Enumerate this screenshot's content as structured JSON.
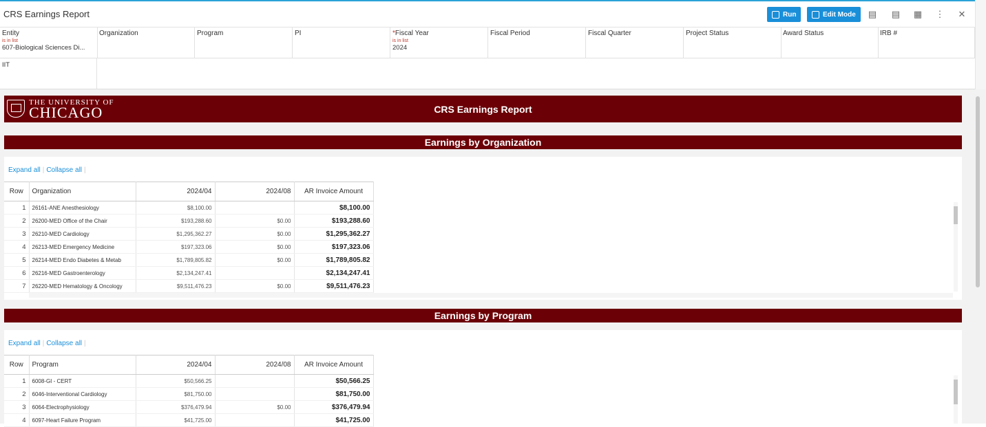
{
  "app": {
    "title": "CRS Earnings Report"
  },
  "toolbar": {
    "run_label": "Run",
    "edit_label": "Edit Mode"
  },
  "filters": [
    {
      "label": "Entity",
      "required": false,
      "op": "is in list",
      "value": "607-Biological Sciences Di..."
    },
    {
      "label": "Organization",
      "required": false,
      "op": "",
      "value": ""
    },
    {
      "label": "Program",
      "required": false,
      "op": "",
      "value": ""
    },
    {
      "label": "PI",
      "required": false,
      "op": "",
      "value": ""
    },
    {
      "label": "Fiscal Year",
      "required": true,
      "op": "is in list",
      "value": "2024"
    },
    {
      "label": "Fiscal Period",
      "required": false,
      "op": "",
      "value": ""
    },
    {
      "label": "Fiscal Quarter",
      "required": false,
      "op": "",
      "value": ""
    },
    {
      "label": "Project Status",
      "required": false,
      "op": "",
      "value": ""
    },
    {
      "label": "Award Status",
      "required": false,
      "op": "",
      "value": ""
    },
    {
      "label": "IRB #",
      "required": false,
      "op": "",
      "value": ""
    }
  ],
  "filter_row2": {
    "label": "IIT"
  },
  "report": {
    "university_line1": "THE UNIVERSITY OF",
    "university_line2": "CHICAGO",
    "title": "CRS Earnings Report",
    "expand_all": "Expand all",
    "collapse_all": "Collapse all",
    "sections": [
      {
        "title": "Earnings by Organization",
        "columns": [
          "Row",
          "Organization",
          "2024/04",
          "2024/08",
          "AR Invoice Amount"
        ],
        "rows": [
          [
            "1",
            "26161-ANE Anesthesiology",
            "$8,100.00",
            "",
            "$8,100.00"
          ],
          [
            "2",
            "26200-MED Office of the Chair",
            "$193,288.60",
            "$0.00",
            "$193,288.60"
          ],
          [
            "3",
            "26210-MED Cardiology",
            "$1,295,362.27",
            "$0.00",
            "$1,295,362.27"
          ],
          [
            "4",
            "26213-MED Emergency Medicine",
            "$197,323.06",
            "$0.00",
            "$197,323.06"
          ],
          [
            "5",
            "26214-MED Endo Diabetes & Metab",
            "$1,789,805.82",
            "$0.00",
            "$1,789,805.82"
          ],
          [
            "6",
            "26216-MED Gastroenterology",
            "$2,134,247.41",
            "",
            "$2,134,247.41"
          ],
          [
            "7",
            "26220-MED Hematology & Oncology",
            "$9,511,476.23",
            "$0.00",
            "$9,511,476.23"
          ]
        ]
      },
      {
        "title": "Earnings by Program",
        "columns": [
          "Row",
          "Program",
          "2024/04",
          "2024/08",
          "AR Invoice Amount"
        ],
        "rows": [
          [
            "1",
            "6008-GI - CERT",
            "$50,566.25",
            "",
            "$50,566.25"
          ],
          [
            "2",
            "6046-Interventional Cardiology",
            "$81,750.00",
            "",
            "$81,750.00"
          ],
          [
            "3",
            "6064-Electrophysiology",
            "$376,479.94",
            "$0.00",
            "$376,479.94"
          ],
          [
            "4",
            "6097-Heart Failure Program",
            "$41,725.00",
            "",
            "$41,725.00"
          ]
        ]
      }
    ]
  }
}
